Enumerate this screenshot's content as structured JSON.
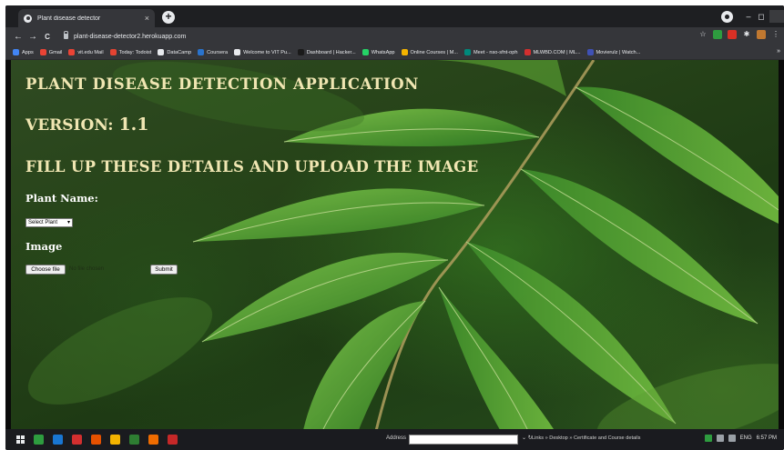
{
  "browser": {
    "tab_title": "Plant disease detector",
    "tab_close_glyph": "×",
    "new_tab_glyph": "+",
    "url": "plant-disease-detector2.herokuapp.com",
    "nav": {
      "back": "←",
      "forward": "→",
      "reload": "C"
    },
    "window": {
      "minimize": "–",
      "maximize": "◻"
    },
    "extensions": [
      {
        "icon": "star-icon",
        "glyph": "☆",
        "color": "#e8eaed"
      },
      {
        "icon": "extension-green-icon",
        "glyph": "",
        "color": "#2e9c3f"
      },
      {
        "icon": "extension-red-icon",
        "glyph": "",
        "color": "#d93025"
      },
      {
        "icon": "puzzle-icon",
        "glyph": "✱",
        "color": "#e8eaed"
      },
      {
        "icon": "profile-avatar-icon",
        "glyph": "",
        "color": "#c07830"
      },
      {
        "icon": "menu-icon",
        "glyph": "⋮",
        "color": "#e8eaed"
      }
    ]
  },
  "bookmarks": [
    {
      "label": "Apps",
      "color": "#4285f4"
    },
    {
      "label": "Gmail",
      "color": "#ea4335"
    },
    {
      "label": "vit.edu Mail",
      "color": "#ea4335"
    },
    {
      "label": "Today: Todoist",
      "color": "#e44332"
    },
    {
      "label": "DataCamp",
      "color": "#e8eaed"
    },
    {
      "label": "Coursera",
      "color": "#2a73cc"
    },
    {
      "label": "Welcome to VIT Pu...",
      "color": "#e8eaed"
    },
    {
      "label": "Dashboard | Hacker...",
      "color": "#1a1a1a"
    },
    {
      "label": "WhatsApp",
      "color": "#25d366"
    },
    {
      "label": "Online Courses | M...",
      "color": "#f4b400"
    },
    {
      "label": "Meet - nso-sfnt-oph",
      "color": "#00897b"
    },
    {
      "label": "MLWBD.COM | ML...",
      "color": "#d32f2f"
    },
    {
      "label": "Movierulz | Watch...",
      "color": "#3f51b5"
    }
  ],
  "bookmarks_more": "»",
  "page": {
    "title": "PLANT DISEASE DETECTION APPLICATION",
    "version_label": "VERSION: ",
    "version_number": "1.1",
    "instructions": "FILL UP THESE DETAILS AND UPLOAD THE IMAGE",
    "plant_name_label": "Plant Name:",
    "plant_select_value": "Select Plant",
    "image_label": "Image",
    "choose_file_label": "Choose file",
    "file_status": "No file chosen",
    "submit_label": "Submit",
    "colors": {
      "heading": "#f0e6b2",
      "label": "#ffffff"
    }
  },
  "taskbar": {
    "address_label": "Address",
    "links_text": "Links  »  Desktop  »  Certificate and Course details",
    "language": "ENG",
    "time": "6:57 PM",
    "apps": [
      {
        "icon": "file-explorer-icon",
        "color": "#2e9c3f"
      },
      {
        "icon": "outlook-icon",
        "color": "#1976d2"
      },
      {
        "icon": "app-red-icon",
        "color": "#d32f2f"
      },
      {
        "icon": "app-orange-icon",
        "color": "#e65100"
      },
      {
        "icon": "chrome-icon",
        "color": "#f4b400"
      },
      {
        "icon": "photos-icon",
        "color": "#2e7d32"
      },
      {
        "icon": "app-orange2-icon",
        "color": "#ef6c00"
      },
      {
        "icon": "app-red2-icon",
        "color": "#c62828"
      }
    ]
  }
}
